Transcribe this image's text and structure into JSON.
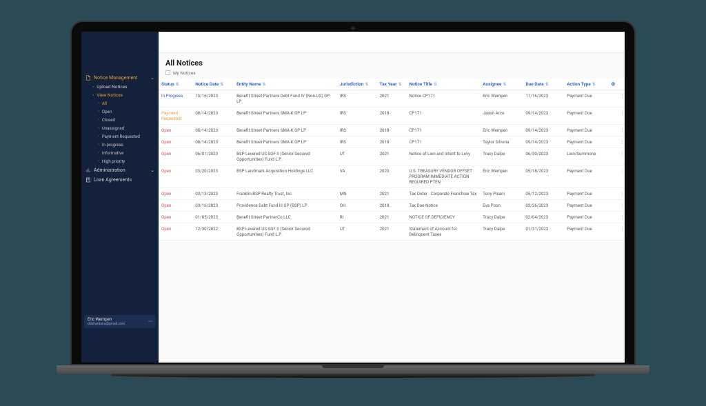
{
  "page": {
    "title": "All Notices",
    "my_notices_label": "My Notices"
  },
  "sidebar": {
    "notice_mgmt": "Notice Management",
    "upload": "Upload Notices",
    "view": "View Notices",
    "leaves": {
      "all": "All",
      "open": "Open",
      "closed": "Closed",
      "unassigned": "Unassigned",
      "payment_requested": "Payment Requested",
      "in_progress": "In progress",
      "informative": "Informative",
      "high_priority": "High priority"
    },
    "administration": "Administration",
    "loan_agreements": "Loan Agreements"
  },
  "user": {
    "name": "Eric Wempen",
    "email": "ddshantanu@gmail.com"
  },
  "columns": {
    "status": "Status",
    "notice_date": "Notice Date",
    "entity": "Entity Name",
    "jurisdiction": "Jurisdiction",
    "tax_year": "Tax Year",
    "notice_title": "Notice Title",
    "assignee": "Assignee",
    "due_date": "Due Date",
    "action_type": "Action Type"
  },
  "rows": [
    {
      "status": "In Progress",
      "status_class": "inprogress",
      "notice_date": "10/16/2023",
      "entity": "Benefit Street Partners Debt Fund IV (Non-US) GP LP",
      "jurisdiction": "IRS",
      "tax_year": "2021",
      "notice_title": "Notice CP171",
      "assignee": "Eric Wempen",
      "due_date": "11/16/2023",
      "action_type": "Payment Due"
    },
    {
      "status": "Payment Requested",
      "status_class": "paymentreq",
      "notice_date": "08/14/2023",
      "entity": "Benefit Street Partners SMA-K GP LP",
      "jurisdiction": "IRS",
      "tax_year": "2018",
      "notice_title": "CP171",
      "assignee": "Jason Arce",
      "due_date": "09/14/2023",
      "action_type": "Payment Due"
    },
    {
      "status": "Open",
      "status_class": "open",
      "notice_date": "08/14/2023",
      "entity": "Benefit Street Partners SMA-K GP LP",
      "jurisdiction": "IRS",
      "tax_year": "2018",
      "notice_title": "CP171",
      "assignee": "Eric Wempen",
      "due_date": "09/14/2023",
      "action_type": "Payment Due"
    },
    {
      "status": "Open",
      "status_class": "open",
      "notice_date": "08/14/2023",
      "entity": "Benefit Street Partners SMA-K GP LP",
      "jurisdiction": "IRS",
      "tax_year": "2018",
      "notice_title": "CP171",
      "assignee": "Taylor Silveria",
      "due_date": "09/14/2023",
      "action_type": "Payment Due"
    },
    {
      "status": "Open",
      "status_class": "open",
      "notice_date": "06/01/2023",
      "entity": "BSP Levered US SOF II (Senior Secured Opportunities) Fund L.P.",
      "jurisdiction": "UT",
      "tax_year": "2021",
      "notice_title": "Notice of Lien and Intent to Levy",
      "assignee": "Tracy Dalpe",
      "due_date": "06/30/2023",
      "action_type": "Lien/Summons"
    },
    {
      "status": "Open",
      "status_class": "open",
      "notice_date": "03/20/2023",
      "entity": "BSP Landmark Acquisition Holdings LLC",
      "jurisdiction": "VA",
      "tax_year": "2020",
      "notice_title": "U.S. TREASURY VENDOR OFFSET PROGRAM IMMEDIATE ACTION REQUIRED PTEN",
      "assignee": "Eric Wempen",
      "due_date": "05/18/2023",
      "action_type": "Payment Due"
    },
    {
      "status": "Open",
      "status_class": "open",
      "notice_date": "03/13/2023",
      "entity": "Franklin BSP Realty Trust, Inc.",
      "jurisdiction": "MN",
      "tax_year": "2021",
      "notice_title": "Tax Order - Corporate Franchise Tax",
      "assignee": "Tony Pisani",
      "due_date": "05/12/2023",
      "action_type": "Payment Due"
    },
    {
      "status": "Open",
      "status_class": "open",
      "notice_date": "03/16/2023",
      "entity": "Providence Debt Fund III GP (BSP) LP",
      "jurisdiction": "OH",
      "tax_year": "2018",
      "notice_title": "Tax Due Notice",
      "assignee": "Eva Poon",
      "due_date": "03/26/2023",
      "action_type": "Payment Due"
    },
    {
      "status": "Open",
      "status_class": "open",
      "notice_date": "01/05/2023",
      "entity": "Benefit Street PartnerCo LLC",
      "jurisdiction": "RI",
      "tax_year": "2021",
      "notice_title": "NOTICE OF DEFICIENCY",
      "assignee": "Tracy Dalpe",
      "due_date": "02/04/2023",
      "action_type": "Payment Due"
    },
    {
      "status": "Open",
      "status_class": "open",
      "notice_date": "12/30/2022",
      "entity": "BSP Levered US SOF II (Senior Secured Opportunities) Fund L.P.",
      "jurisdiction": "UT",
      "tax_year": "2021",
      "notice_title": "Statement of Account for Delinquent Taxes",
      "assignee": "Tracy Dalpe",
      "due_date": "01/31/2023",
      "action_type": "Payment Due"
    }
  ]
}
